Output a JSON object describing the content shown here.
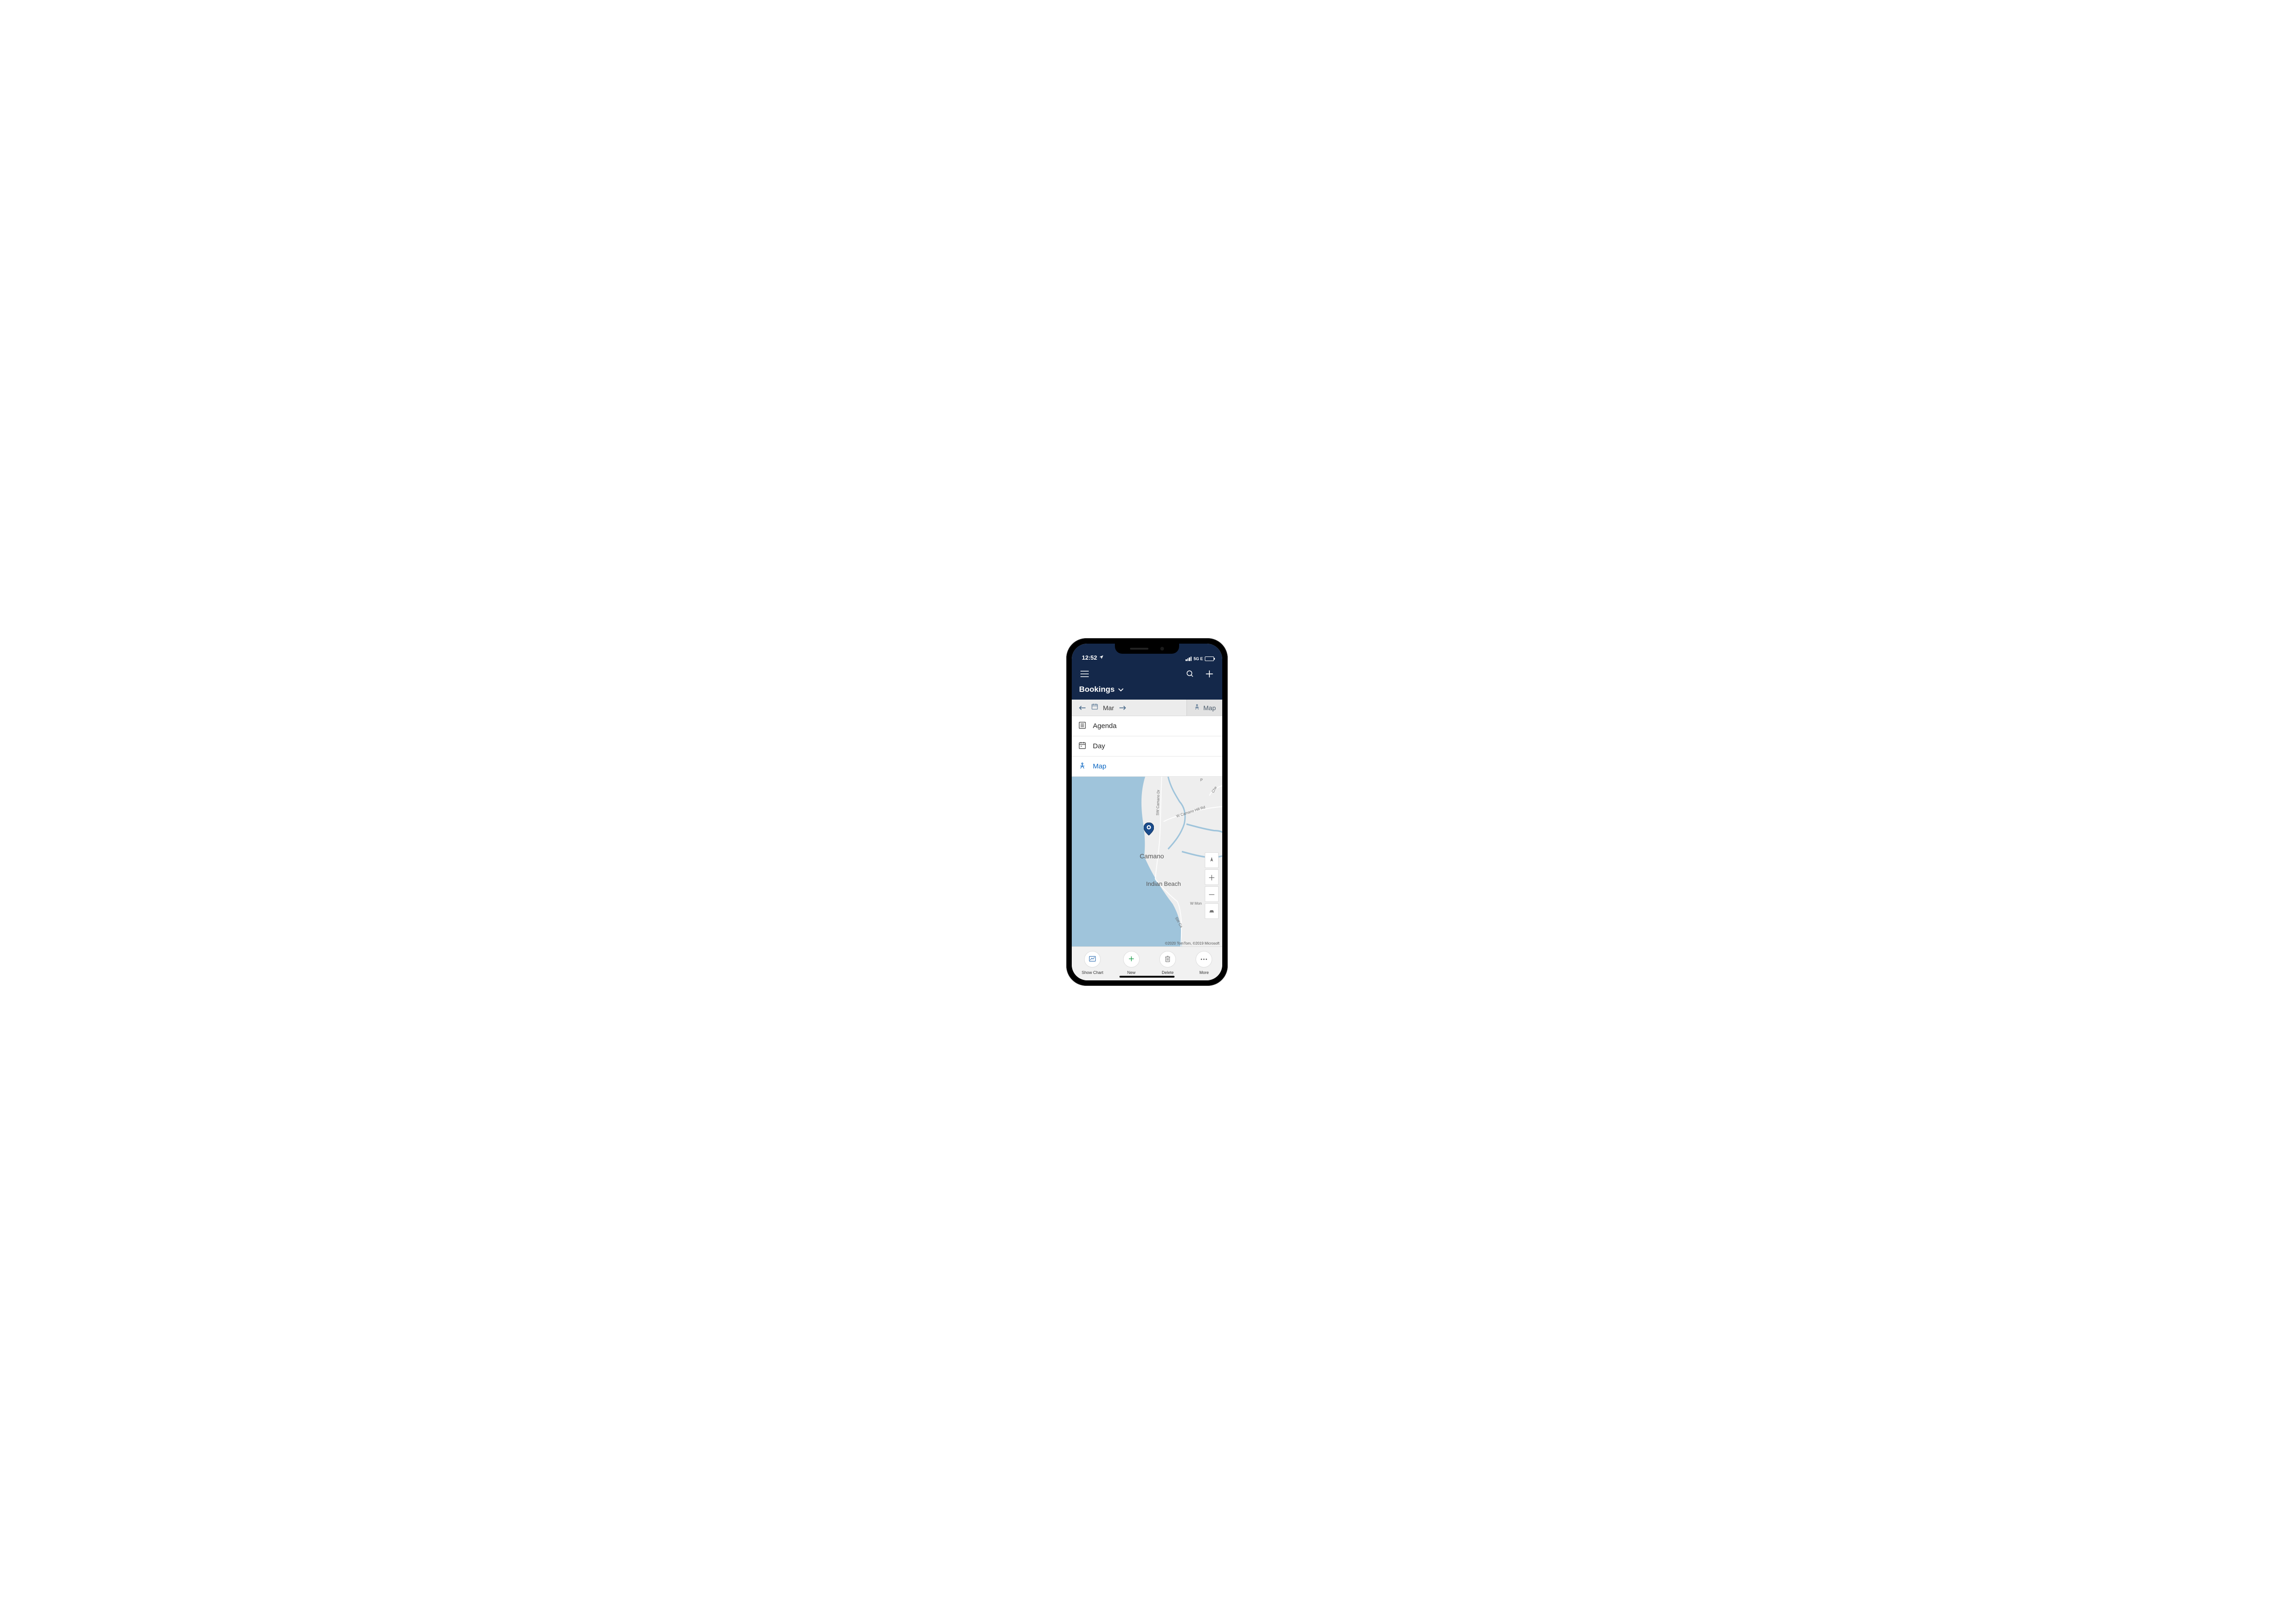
{
  "status": {
    "time": "12:52",
    "network_label": "5G E"
  },
  "header": {
    "title": "Bookings"
  },
  "datebar": {
    "month_label": "Mar",
    "toggle_label": "Map"
  },
  "views": {
    "agenda": "Agenda",
    "day": "Day",
    "map": "Map"
  },
  "map": {
    "attribution": "©2020 TomTom, ©2019 Microsoft",
    "labels": {
      "camano": "Camano",
      "indian_beach": "Indian Beach",
      "sw_camano_dr": "SW Camano Dr",
      "w_camano_hill_rd": "W Camano Hill Rd",
      "w_mon": "W Mon",
      "che": "Che",
      "p": "P",
      "sw_ca": "SW Ca"
    }
  },
  "bottom": {
    "show_chart": "Show Chart",
    "new": "New",
    "delete": "Delete",
    "more": "More"
  }
}
